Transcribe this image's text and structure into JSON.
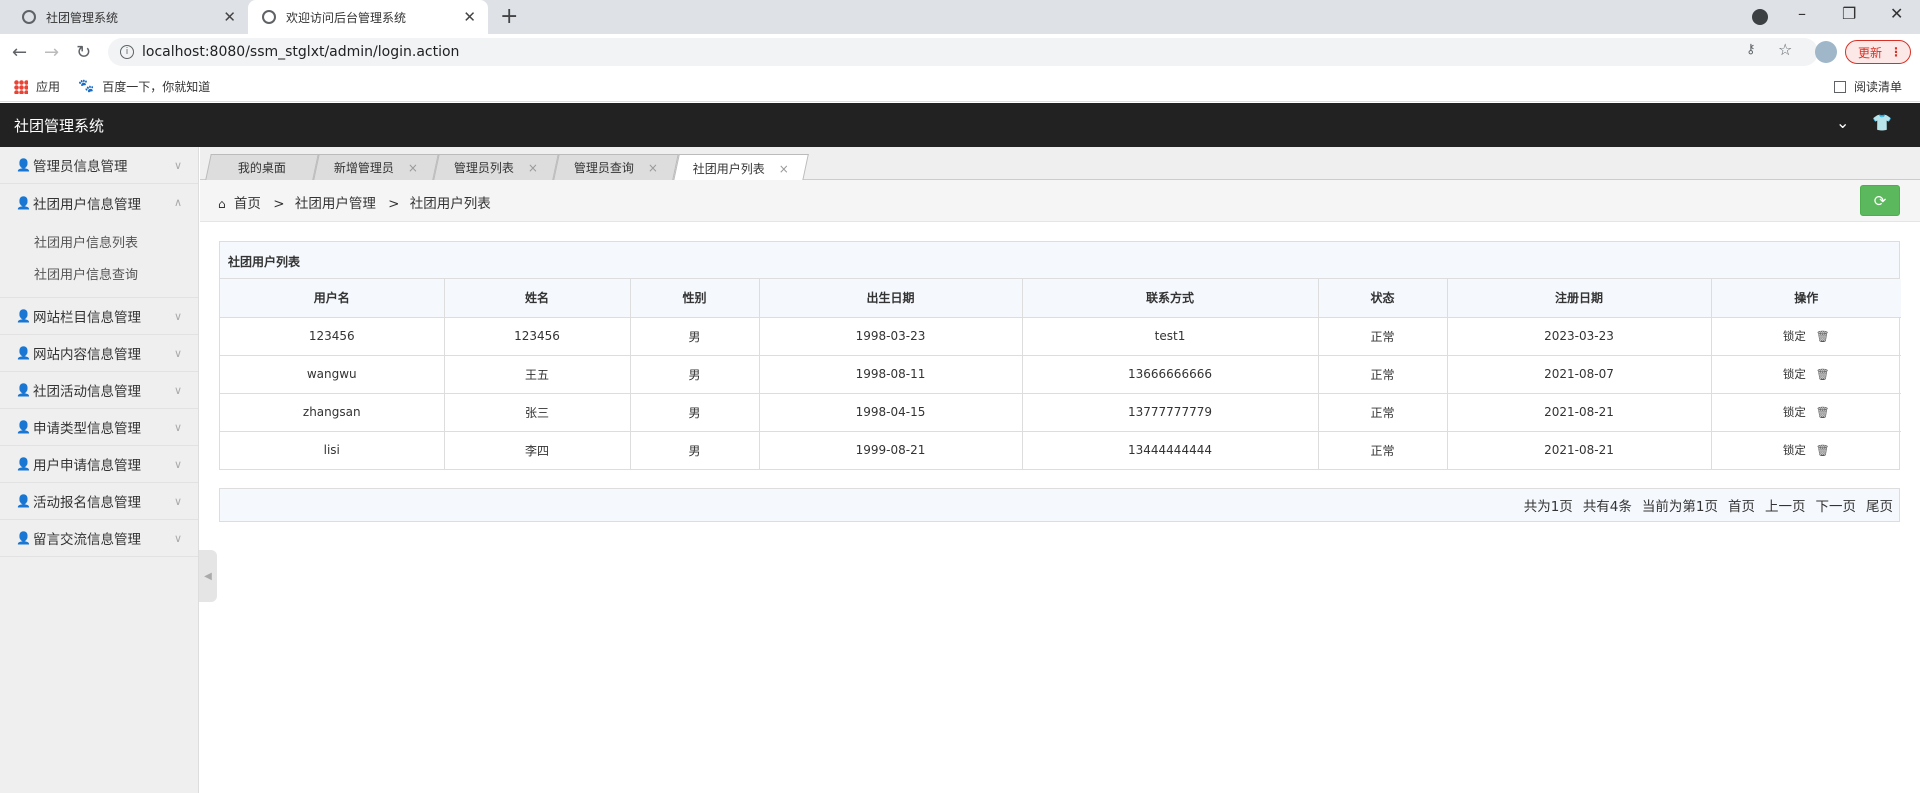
{
  "browser": {
    "tabs": [
      {
        "title": "社团管理系统"
      },
      {
        "title": "欢迎访问后台管理系统"
      }
    ],
    "url": "localhost:8080/ssm_stglxt/admin/login.action",
    "update_label": "更新",
    "bookmarks": {
      "apps": "应用",
      "baidu": "百度一下，你就知道",
      "reading": "阅读清单"
    }
  },
  "app": {
    "title": "社团管理系统"
  },
  "sidebar": {
    "menus": [
      {
        "label": "管理员信息管理"
      },
      {
        "label": "社团用户信息管理"
      },
      {
        "label": "网站栏目信息管理"
      },
      {
        "label": "网站内容信息管理"
      },
      {
        "label": "社团活动信息管理"
      },
      {
        "label": "申请类型信息管理"
      },
      {
        "label": "用户申请信息管理"
      },
      {
        "label": "活动报名信息管理"
      },
      {
        "label": "留言交流信息管理"
      }
    ],
    "submenus": [
      "社团用户信息列表",
      "社团用户信息查询"
    ]
  },
  "content_tabs": [
    {
      "label": "我的桌面"
    },
    {
      "label": "新增管理员"
    },
    {
      "label": "管理员列表"
    },
    {
      "label": "管理员查询"
    },
    {
      "label": "社团用户列表"
    }
  ],
  "breadcrumb": {
    "home": "首页",
    "level1": "社团用户管理",
    "level2": "社团用户列表",
    "sep": ">"
  },
  "table": {
    "caption": "社团用户列表",
    "headers": [
      "用户名",
      "姓名",
      "性别",
      "出生日期",
      "联系方式",
      "状态",
      "注册日期",
      "操作"
    ],
    "rows": [
      [
        "123456",
        "123456",
        "男",
        "1998-03-23",
        "test1",
        "正常",
        "2023-03-23"
      ],
      [
        "wangwu",
        "王五",
        "男",
        "1998-08-11",
        "13666666666",
        "正常",
        "2021-08-07"
      ],
      [
        "zhangsan",
        "张三",
        "男",
        "1998-04-15",
        "13777777779",
        "正常",
        "2021-08-21"
      ],
      [
        "lisi",
        "李四",
        "男",
        "1999-08-21",
        "13444444444",
        "正常",
        "2021-08-21"
      ]
    ],
    "action_lock": "锁定"
  },
  "pager": {
    "total_pages": "共为1页",
    "total_items": "共有4条",
    "current": "当前为第1页",
    "first": "首页",
    "prev": "上一页",
    "next": "下一页",
    "last": "尾页"
  }
}
